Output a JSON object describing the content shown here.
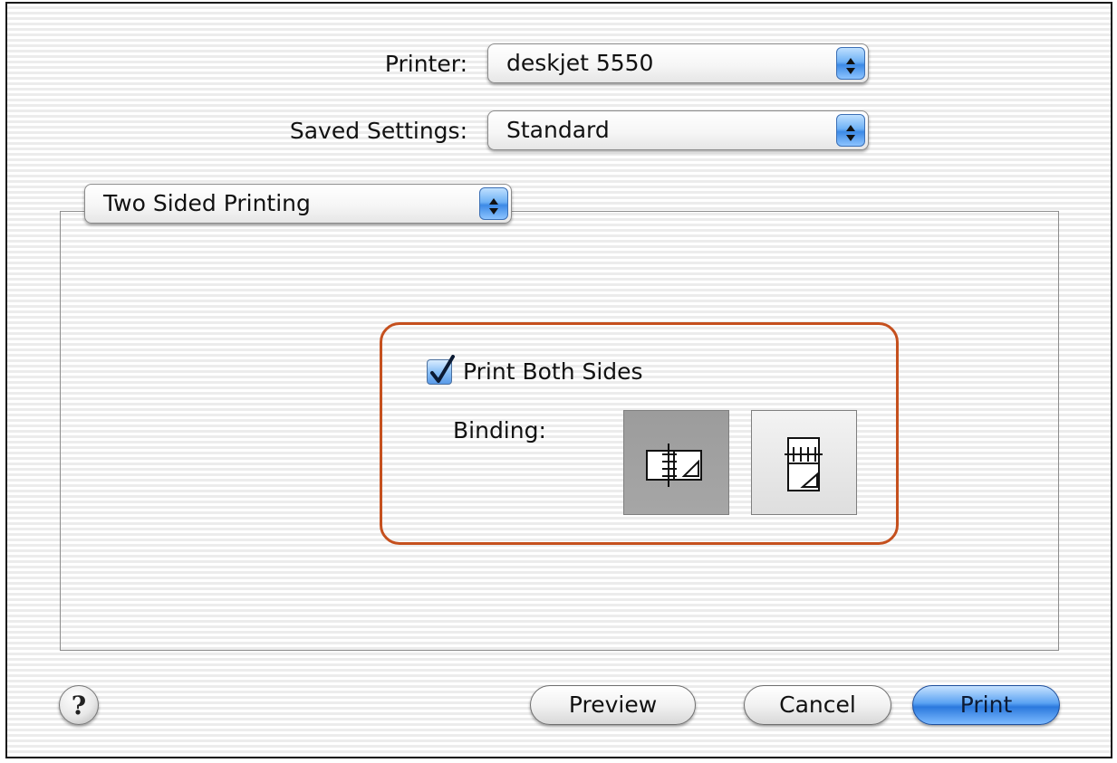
{
  "printer": {
    "label": "Printer:",
    "value": "deskjet 5550"
  },
  "saved_settings": {
    "label": "Saved Settings:",
    "value": "Standard"
  },
  "panel": {
    "value": "Two Sided Printing"
  },
  "options": {
    "print_both_sides_label": "Print Both Sides",
    "print_both_sides_checked": true,
    "binding_label": "Binding:",
    "binding_selected": "left-edge"
  },
  "buttons": {
    "help": "?",
    "preview": "Preview",
    "cancel": "Cancel",
    "print": "Print"
  },
  "colors": {
    "highlight_border": "#c5501e",
    "primary_button": "#2b79dd"
  }
}
